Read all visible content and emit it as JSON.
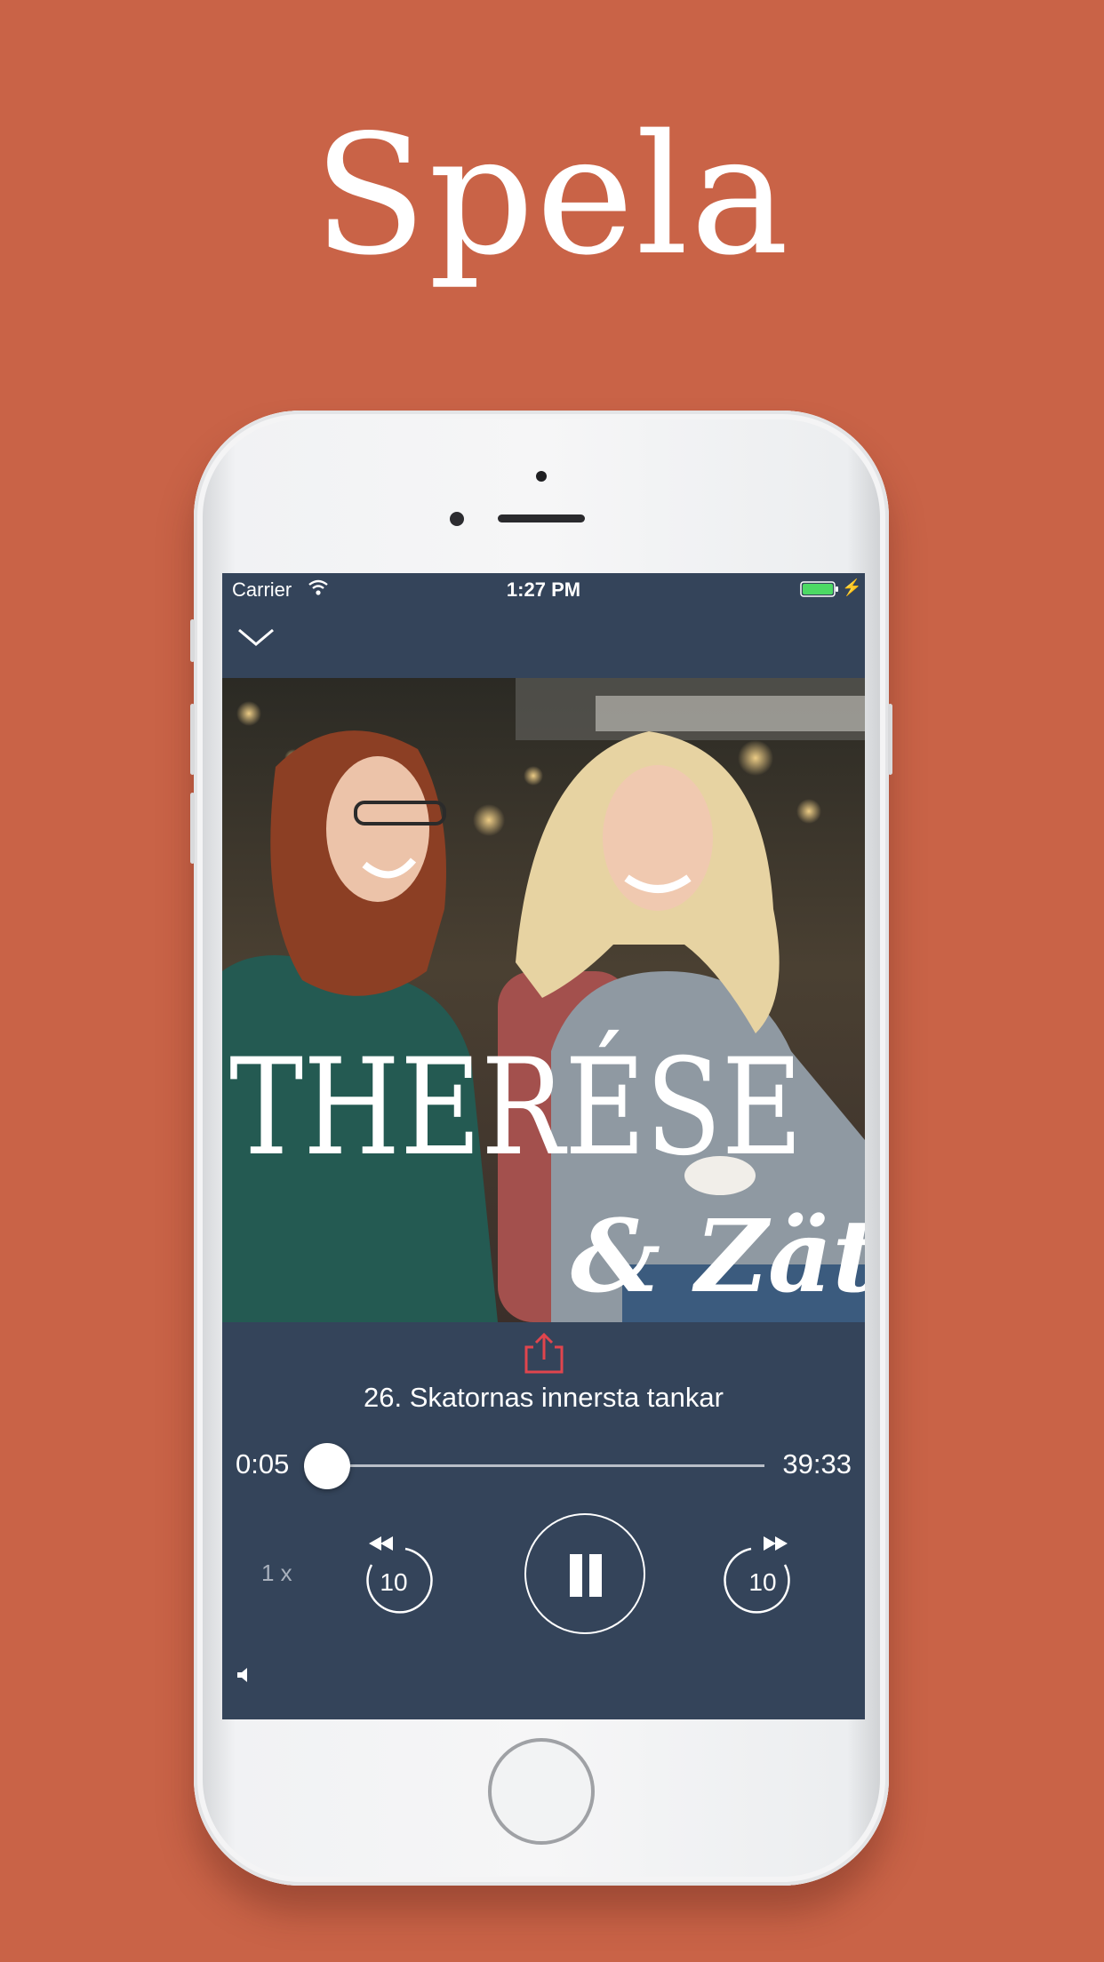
{
  "headline": "Spela",
  "status_bar": {
    "carrier": "Carrier",
    "time": "1:27 PM",
    "battery_color": "#4cd964"
  },
  "artwork": {
    "title_line1": "THERÉSE",
    "title_line2": "& Zäta"
  },
  "player": {
    "episode_title": "26. Skatornas innersta tankar",
    "elapsed": "0:05",
    "total": "39:33",
    "progress_fraction": 0.002,
    "speed_label": "1 x",
    "skip_back_label": "10",
    "skip_forward_label": "10",
    "accent_color": "#e0454d"
  },
  "colors": {
    "background": "#c96347",
    "screen": "#34445a"
  },
  "icons": [
    "collapse-chevron-icon",
    "wifi-icon",
    "battery-icon",
    "share-icon",
    "skip-back-icon",
    "pause-icon",
    "skip-forward-icon",
    "volume-icon"
  ]
}
